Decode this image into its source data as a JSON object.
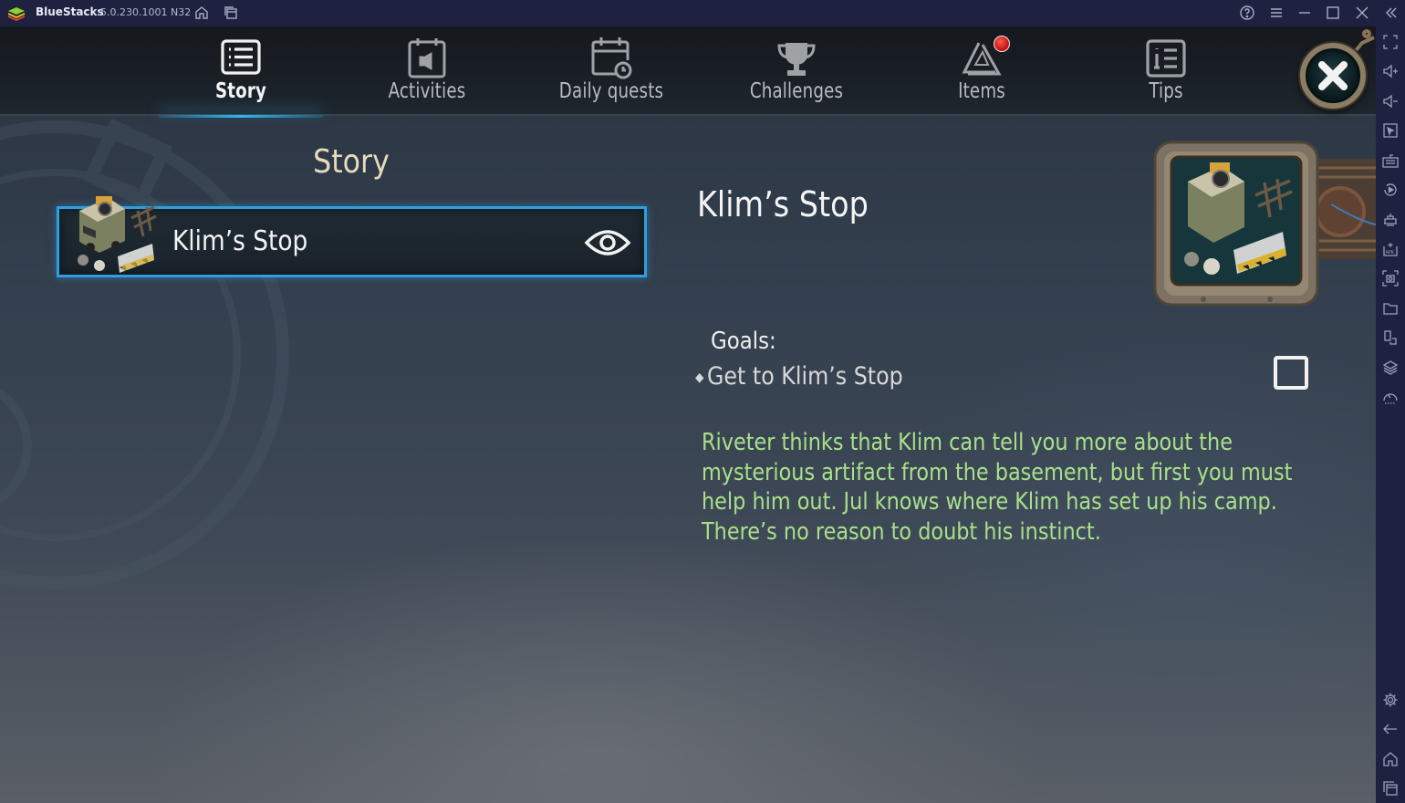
{
  "window": {
    "app_name": "BlueStacks",
    "version": "5.0.230.1001 N32",
    "controls": [
      "help-icon",
      "menu-icon",
      "minimize-icon",
      "maximize-icon",
      "close-icon",
      "collapse-sidebar-icon"
    ]
  },
  "sidebar": {
    "top_icons": [
      "fullscreen-icon",
      "volume-up-icon",
      "volume-down-icon",
      "pointer-icon",
      "keyboard-icon",
      "replay-icon",
      "macro-icon",
      "install-apk-icon",
      "screenshot-icon",
      "folder-icon",
      "multi-instance-icon",
      "layers-icon",
      "performance-icon"
    ],
    "bottom_icons": [
      "settings-icon",
      "back-icon",
      "home-icon",
      "recent-apps-icon"
    ]
  },
  "nav": {
    "tabs": [
      {
        "label": "Story",
        "icon": "story-list-icon",
        "active": true
      },
      {
        "label": "Activities",
        "icon": "activities-calendar-icon",
        "active": false
      },
      {
        "label": "Daily quests",
        "icon": "daily-quests-calendar-icon",
        "active": false
      },
      {
        "label": "Challenges",
        "icon": "trophy-icon",
        "active": false
      },
      {
        "label": "Items",
        "icon": "items-triangle-icon",
        "active": false,
        "has_notification": true
      },
      {
        "label": "Tips",
        "icon": "tips-info-icon",
        "active": false
      }
    ],
    "accent_color": "#2fb6f0",
    "notification_color": "#d81d1d"
  },
  "story": {
    "section_title": "Story",
    "quests": [
      {
        "name": "Klim’s Stop",
        "selected": true
      }
    ]
  },
  "detail": {
    "title": "Klim’s Stop",
    "goals_label": "Goals:",
    "goals": [
      {
        "text": "Get to Klim’s Stop",
        "completed": false
      }
    ],
    "description": "Riveter thinks that Klim can tell you more about the mysterious artifact from the basement, but first you must help him out. Jul knows where Klim has set up his camp. There’s no reason to doubt his instinct.",
    "description_color": "#a8e08a"
  }
}
